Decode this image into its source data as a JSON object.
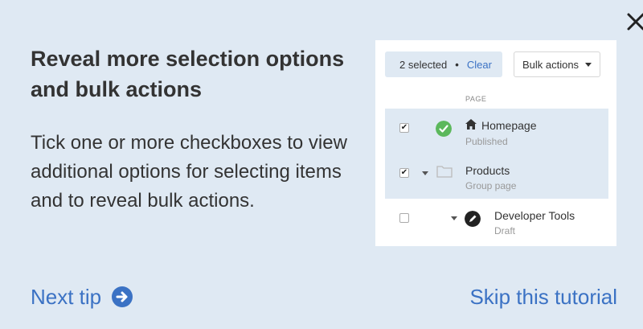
{
  "close_label": "×",
  "title": "Reveal more selection options and bulk actions",
  "description": "Tick one or more checkboxes to view additional options for selecting items and to reveal bulk actions.",
  "next_tip": {
    "label": "Next tip",
    "icon": "arrow-right-circle-icon"
  },
  "skip_label": "Skip this tutorial",
  "preview": {
    "selection": {
      "count_text": "2 selected",
      "separator": "•",
      "clear_label": "Clear"
    },
    "bulk_actions_label": "Bulk actions",
    "column_header": "PAGE",
    "rows": [
      {
        "name": "Homepage",
        "status": "Published",
        "checked": true,
        "icon": "home-icon",
        "status_icon": "check-circle-icon"
      },
      {
        "name": "Products",
        "status": "Group page",
        "checked": true,
        "icon": "folder-icon"
      },
      {
        "name": "Developer Tools",
        "status": "Draft",
        "checked": false,
        "icon": "pencil-circle-icon"
      }
    ]
  },
  "colors": {
    "background": "#dfe9f3",
    "link": "#3b72c4",
    "published": "#5cb85c"
  }
}
